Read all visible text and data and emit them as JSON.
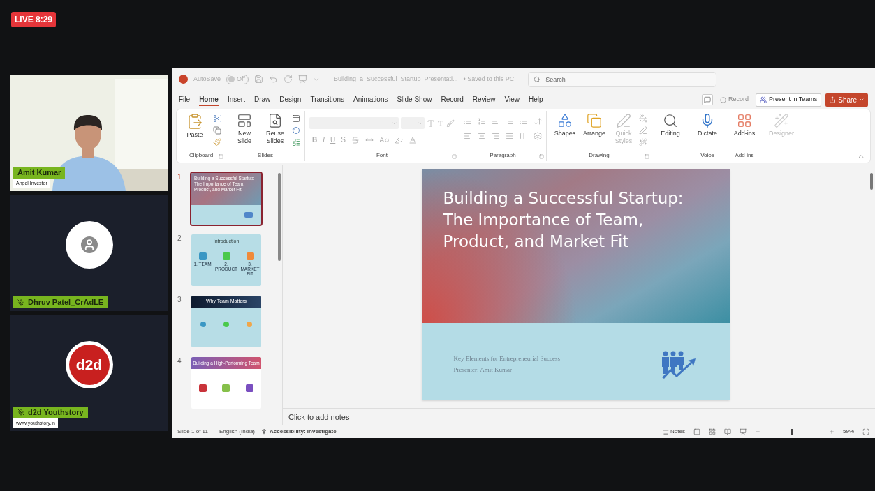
{
  "live_badge": "LIVE 8:29",
  "participants": [
    {
      "kind": "video",
      "name": "Amit Kumar",
      "subtitle": "Angel Investor",
      "muted": false
    },
    {
      "kind": "avatar",
      "name": "Dhruv Patel_CrAdLE",
      "muted": true
    },
    {
      "kind": "logo",
      "logo_text": "d2d",
      "name": "d2d Youthstory",
      "subtitle": "www.youthstory.in",
      "muted": true
    }
  ],
  "powerpoint": {
    "title_bar": {
      "autosave_label": "AutoSave",
      "autosave_toggle": {
        "label": "Off",
        "on": false
      },
      "file_name": "Building_a_Successful_Startup_Presentati...",
      "save_status": "• Saved to this PC",
      "search": {
        "placeholder": "Search"
      }
    },
    "menu_tabs": [
      {
        "label": "File",
        "selected": false
      },
      {
        "label": "Home",
        "selected": true
      },
      {
        "label": "Insert",
        "selected": false
      },
      {
        "label": "Draw",
        "selected": false
      },
      {
        "label": "Design",
        "selected": false
      },
      {
        "label": "Transitions",
        "selected": false
      },
      {
        "label": "Animations",
        "selected": false
      },
      {
        "label": "Slide Show",
        "selected": false
      },
      {
        "label": "Record",
        "selected": false
      },
      {
        "label": "Review",
        "selected": false
      },
      {
        "label": "View",
        "selected": false
      },
      {
        "label": "Help",
        "selected": false
      }
    ],
    "actions": [
      {
        "kind": "record",
        "label": "Record",
        "disabled": true
      },
      {
        "kind": "teams",
        "label": "Present in Teams",
        "disabled": false
      },
      {
        "kind": "share",
        "label": "Share",
        "disabled": false
      }
    ],
    "ribbon_groups": [
      {
        "kind": "clipboard",
        "label": "Clipboard",
        "launcher": true,
        "buttons": [
          {
            "label": "Paste",
            "disabled": false
          }
        ]
      },
      {
        "kind": "slides",
        "label": "Slides",
        "launcher": false,
        "buttons": [
          {
            "label": "New Slide",
            "disabled": false
          },
          {
            "label": "Reuse Slides",
            "disabled": false
          }
        ]
      },
      {
        "kind": "font",
        "label": "Font",
        "launcher": true,
        "format_buttons": [
          "B",
          "I",
          "U",
          "S"
        ]
      },
      {
        "kind": "paragraph",
        "label": "Paragraph",
        "launcher": true
      },
      {
        "kind": "drawing",
        "label": "Drawing",
        "launcher": true,
        "buttons": [
          {
            "label": "Shapes",
            "disabled": false
          },
          {
            "label": "Arrange",
            "disabled": false
          },
          {
            "label": "Quick Styles",
            "disabled": true
          }
        ]
      },
      {
        "kind": "editing",
        "launcher": false,
        "buttons": [
          {
            "label": "Editing",
            "disabled": false
          }
        ]
      },
      {
        "kind": "voice",
        "label": "Voice",
        "launcher": false,
        "buttons": [
          {
            "label": "Dictate",
            "disabled": false
          }
        ]
      },
      {
        "kind": "addins",
        "label": "Add-ins",
        "launcher": false,
        "buttons": [
          {
            "label": "Add-ins",
            "disabled": false
          }
        ]
      },
      {
        "kind": "designer",
        "launcher": false,
        "buttons": [
          {
            "label": "Designer",
            "disabled": true
          }
        ]
      }
    ],
    "thumbnails": [
      {
        "number": "1",
        "selected": true,
        "kind": "title",
        "title": "Building a Successful Startup: The Importance of Team, Product, and Market Fit"
      },
      {
        "number": "2",
        "selected": false,
        "kind": "cards",
        "title": "Introduction",
        "labels": [
          "1. TEAM",
          "2. PRODUCT",
          "3. MARKET FIT"
        ]
      },
      {
        "number": "3",
        "selected": false,
        "kind": "dark_header",
        "title": "Why Team Matters"
      },
      {
        "number": "4",
        "selected": false,
        "kind": "gradient_header",
        "title": "Building a High-Performing Team"
      }
    ],
    "slide": {
      "title": "Building a Successful Startup: The Importance of Team, Product, and Market Fit",
      "subtitle_lines": [
        "Key Elements for Entrepreneurial Success",
        "Presenter: Amit Kumar"
      ]
    },
    "notes": {
      "placeholder": "Click to add notes"
    },
    "status_bar": {
      "slide_count": "Slide 1 of 11",
      "language": "English (India)",
      "accessibility": "Accessibility: Investigate",
      "notes_button": "Notes",
      "zoom": {
        "level": 0.45,
        "reading": "59%"
      }
    }
  }
}
